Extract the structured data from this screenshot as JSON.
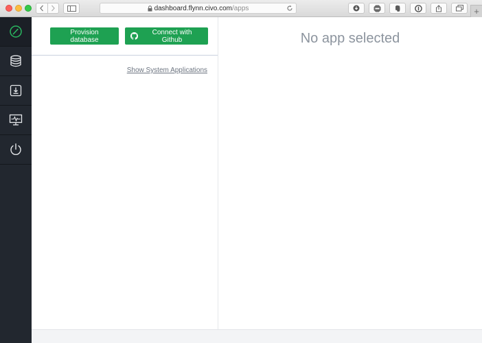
{
  "browser": {
    "url_host": "dashboard.flynn.civo.com",
    "url_path": "/apps",
    "newtab_label": "+"
  },
  "sidebar": {
    "items": [
      {
        "icon": "dashboard-gauge-icon",
        "active": true
      },
      {
        "icon": "database-icon"
      },
      {
        "icon": "download-icon"
      },
      {
        "icon": "monitor-icon"
      },
      {
        "icon": "power-icon"
      }
    ]
  },
  "apps": {
    "provision_label": "Provision database",
    "github_label": "Connect with Github",
    "system_apps_link": "Show System Applications"
  },
  "detail": {
    "empty_title": "No app selected"
  },
  "colors": {
    "accent_green": "#1ea152",
    "sidebar_bg": "#22272f",
    "active_icon": "#2ab860"
  }
}
